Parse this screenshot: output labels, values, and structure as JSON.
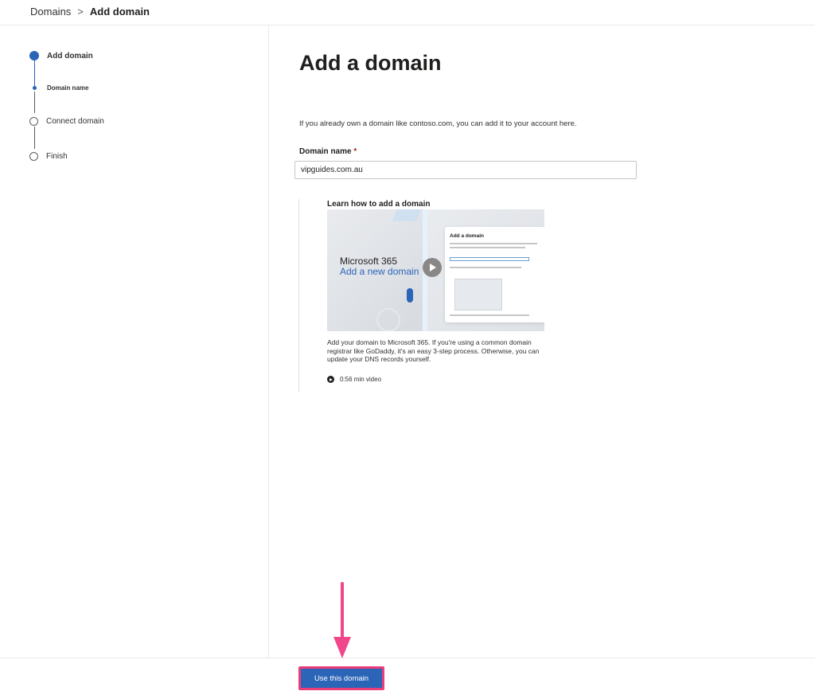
{
  "breadcrumb": {
    "root": "Domains",
    "separator": ">",
    "current": "Add domain"
  },
  "wizard": {
    "steps": [
      {
        "label": "Add domain",
        "state": "active"
      },
      {
        "label": "Domain name",
        "state": "sub-active"
      },
      {
        "label": "Connect domain",
        "state": "pending"
      },
      {
        "label": "Finish",
        "state": "pending"
      }
    ]
  },
  "main": {
    "title": "Add a domain",
    "intro": "If you already own a domain like contoso.com, you can add it to your account here.",
    "domain_label": "Domain name",
    "required_mark": "*",
    "domain_value": "vipguides.com.au"
  },
  "video": {
    "title": "Learn how to add a domain",
    "thumbnail_brand": "Microsoft 365",
    "thumbnail_subtitle": "Add a new domain",
    "thumbnail_panel_title": "Add a domain",
    "description": "Add your domain to Microsoft 365. If you're using a common domain registrar like GoDaddy, it's an easy 3-step process. Otherwise, you can update your DNS records yourself.",
    "duration": "0:56 min video"
  },
  "footer": {
    "primary_label": "Use this domain"
  },
  "colors": {
    "accent": "#2b65b8",
    "annotation": "#f0478a",
    "required": "#a4262c"
  }
}
